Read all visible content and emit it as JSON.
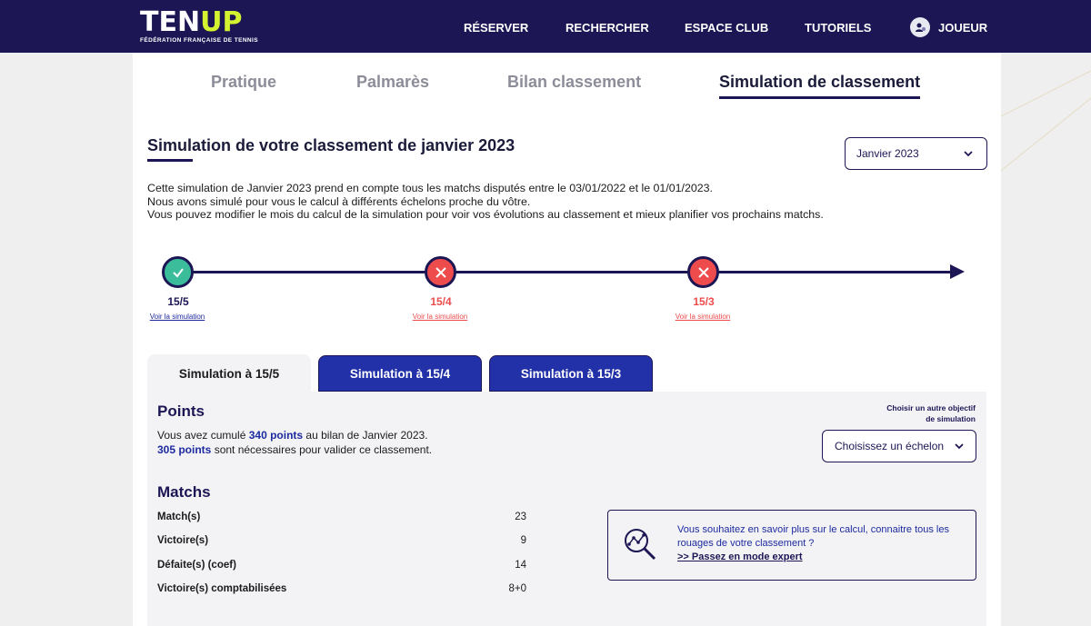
{
  "header": {
    "logo_main_a": "TEN",
    "logo_main_b": "UP",
    "logo_sub": "FÉDÉRATION FRANÇAISE DE TENNIS",
    "nav": [
      {
        "label": "RÉSERVER"
      },
      {
        "label": "RECHERCHER"
      },
      {
        "label": "ESPACE CLUB"
      },
      {
        "label": "TUTORIELS"
      }
    ],
    "player_label": "JOUEUR"
  },
  "tabs": [
    {
      "label": "Pratique"
    },
    {
      "label": "Palmarès"
    },
    {
      "label": "Bilan classement"
    },
    {
      "label": "Simulation de classement",
      "active": true
    }
  ],
  "section": {
    "title": "Simulation de votre classement de janvier 2023",
    "month_select": "Janvier 2023",
    "intro": [
      "Cette simulation de Janvier 2023 prend en compte tous les matchs disputés entre le 03/01/2022 et le 01/01/2023.",
      "Nous avons simulé pour vous le calcul à différents échelons proche du vôtre.",
      "Vous pouvez modifier le mois du calcul de la simulation pour voir vos évolutions au classement et mieux planifier vos prochains matchs."
    ]
  },
  "timeline": [
    {
      "rank": "15/5",
      "status": "ok",
      "link": "Voir la simulation"
    },
    {
      "rank": "15/4",
      "status": "ko",
      "link": "Voir la simulation"
    },
    {
      "rank": "15/3",
      "status": "ko",
      "link": "Voir la simulation"
    }
  ],
  "colors": {
    "ok": "#3bbd9c",
    "ko": "#ee4c4c",
    "navy": "#1c1654",
    "blue": "#2331a8",
    "lime": "#d4f230"
  },
  "sim_tabs": [
    {
      "label": "Simulation à 15/5",
      "active": true
    },
    {
      "label": "Simulation à 15/4",
      "active": false
    },
    {
      "label": "Simulation à 15/3",
      "active": false
    }
  ],
  "points": {
    "title": "Points",
    "line1_pre": "Vous avez cumulé ",
    "line1_bold": "340 points",
    "line1_post": " au bilan de Janvier 2023.",
    "line2_bold": "305 points",
    "line2_post": " sont nécessaires pour valider ce classement.",
    "objective_label_1": "Choisir un autre objectif",
    "objective_label_2": "de simulation",
    "echelon_select": "Choisissez un échelon"
  },
  "matchs": {
    "title": "Matchs",
    "rows": [
      {
        "label": "Match(s)",
        "value": "23"
      },
      {
        "label": "Victoire(s)",
        "value": "9"
      },
      {
        "label": "Défaite(s) (coef)",
        "value": "14"
      },
      {
        "label": "Victoire(s) comptabilisées",
        "value": "8+0"
      }
    ]
  },
  "expert": {
    "text": "Vous souhaitez en savoir plus sur le calcul, connaitre tous les rouages de votre classement ?",
    "link": ">> Passez en mode expert",
    "icon": "magnifier-chart-icon"
  }
}
